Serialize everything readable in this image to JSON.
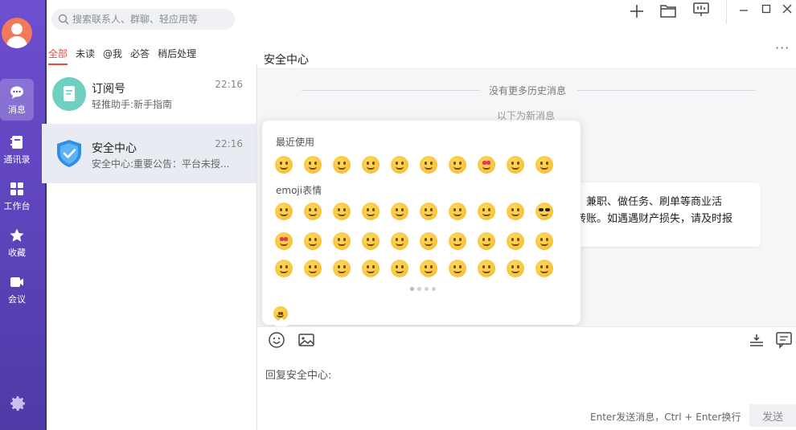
{
  "search": {
    "placeholder": "搜索联系人、群聊、轻应用等"
  },
  "nav": {
    "items": [
      {
        "label": "消息",
        "icon": "chat-bubble-icon"
      },
      {
        "label": "通讯录",
        "icon": "contacts-icon"
      },
      {
        "label": "工作台",
        "icon": "grid-icon"
      },
      {
        "label": "收藏",
        "icon": "star-icon"
      },
      {
        "label": "会议",
        "icon": "video-icon"
      }
    ]
  },
  "filters": [
    "全部",
    "未读",
    "@我",
    "必答",
    "稍后处理"
  ],
  "conversations": [
    {
      "name": "订阅号",
      "time": "22:16",
      "preview": "轻推助手:新手指南"
    },
    {
      "name": "安全中心",
      "time": "22:16",
      "preview": "安全中心:重要公告：平台未授..."
    }
  ],
  "chat": {
    "title": "安全中心",
    "more": "···",
    "no_history": "没有更多历史消息",
    "new_messages": "以下为新消息",
    "bubble_line1": "、兼职、做任务、刷单等商业活",
    "bubble_line2": "转账。如遇遇财产损失，请及时报"
  },
  "emoji_panel": {
    "recent_label": "最近使用",
    "emoji_label": "emoji表情"
  },
  "input": {
    "reply_label": "回复安全中心:",
    "hint": "Enter发送消息，Ctrl + Enter换行",
    "send_label": "发送"
  },
  "colors": {
    "accent": "#e24b3b",
    "rail": "#5b42b8"
  }
}
